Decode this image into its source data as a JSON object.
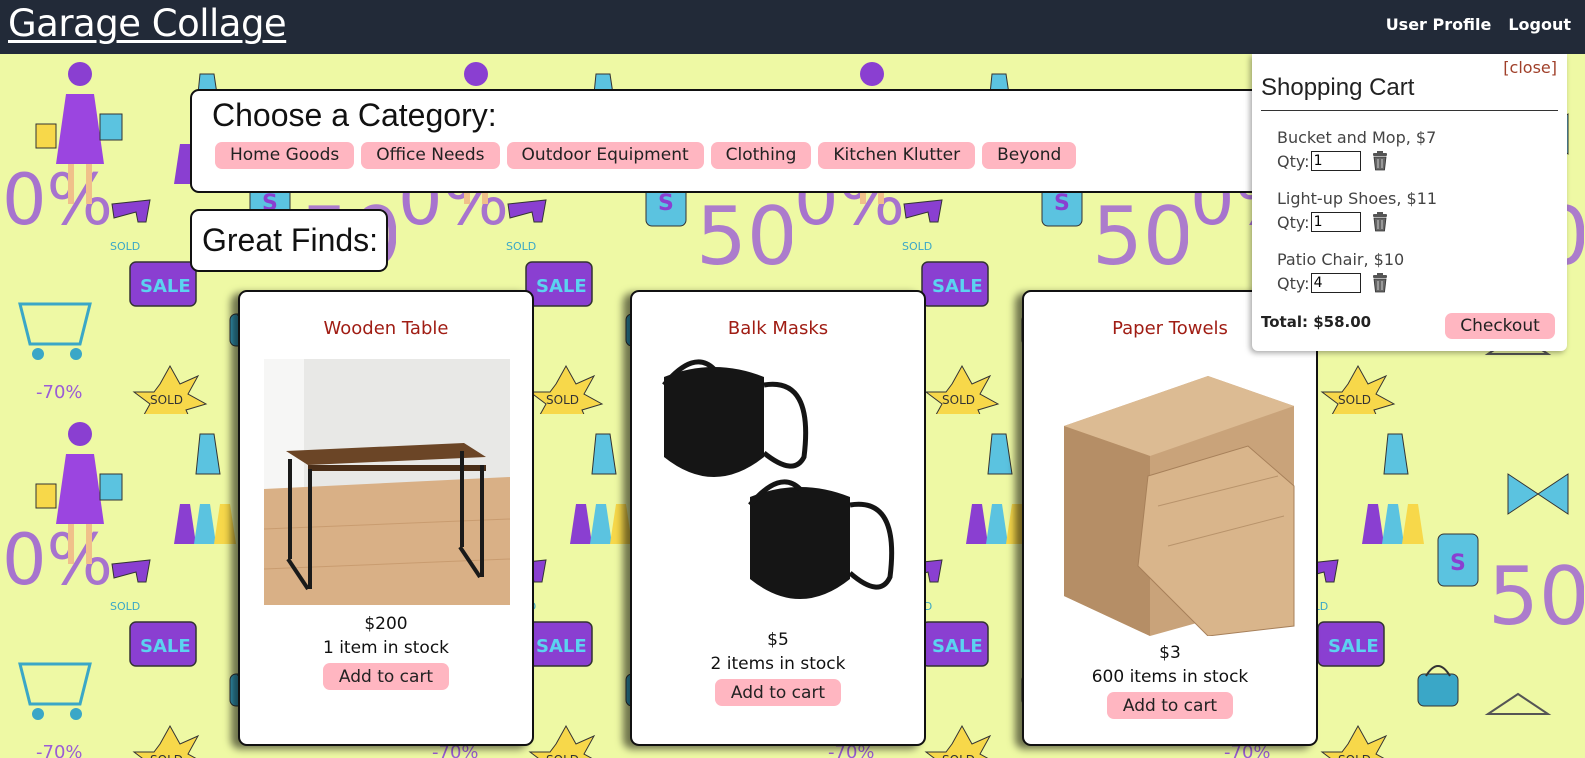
{
  "header": {
    "brand": "Garage Collage",
    "nav": {
      "profile": "User Profile",
      "logout": "Logout"
    }
  },
  "categories": {
    "title": "Choose a Category:",
    "items": [
      "Home Goods",
      "Office Needs",
      "Outdoor Equipment",
      "Clothing",
      "Kitchen Klutter",
      "Beyond"
    ]
  },
  "finds": {
    "title": "Great Finds:",
    "products": [
      {
        "name": "Wooden Table",
        "price": "$200",
        "stock": "1 item in stock",
        "button": "Add to cart",
        "image": "wooden-table-image"
      },
      {
        "name": "Balk Masks",
        "price": "$5",
        "stock": "2 items in stock",
        "button": "Add to cart",
        "image": "face-masks-image"
      },
      {
        "name": "Paper Towels",
        "price": "$3",
        "stock": "600 items in stock",
        "button": "Add to cart",
        "image": "paper-towels-image"
      }
    ]
  },
  "cart": {
    "close": "[close]",
    "title": "Shopping Cart",
    "qty_label": "Qty:",
    "items": [
      {
        "name": "Bucket and Mop, $7",
        "qty": "1"
      },
      {
        "name": "Light-up Shoes, $11",
        "qty": "1"
      },
      {
        "name": "Patio Chair, $10",
        "qty": "4"
      }
    ],
    "total": "Total: $58.00",
    "checkout": "Checkout",
    "trash_icon": "trash-icon"
  },
  "colors": {
    "header_bg": "#222a38",
    "pill": "#ffb6c1",
    "product_name": "#a01d14",
    "wallpaper": "#eef9a4"
  }
}
